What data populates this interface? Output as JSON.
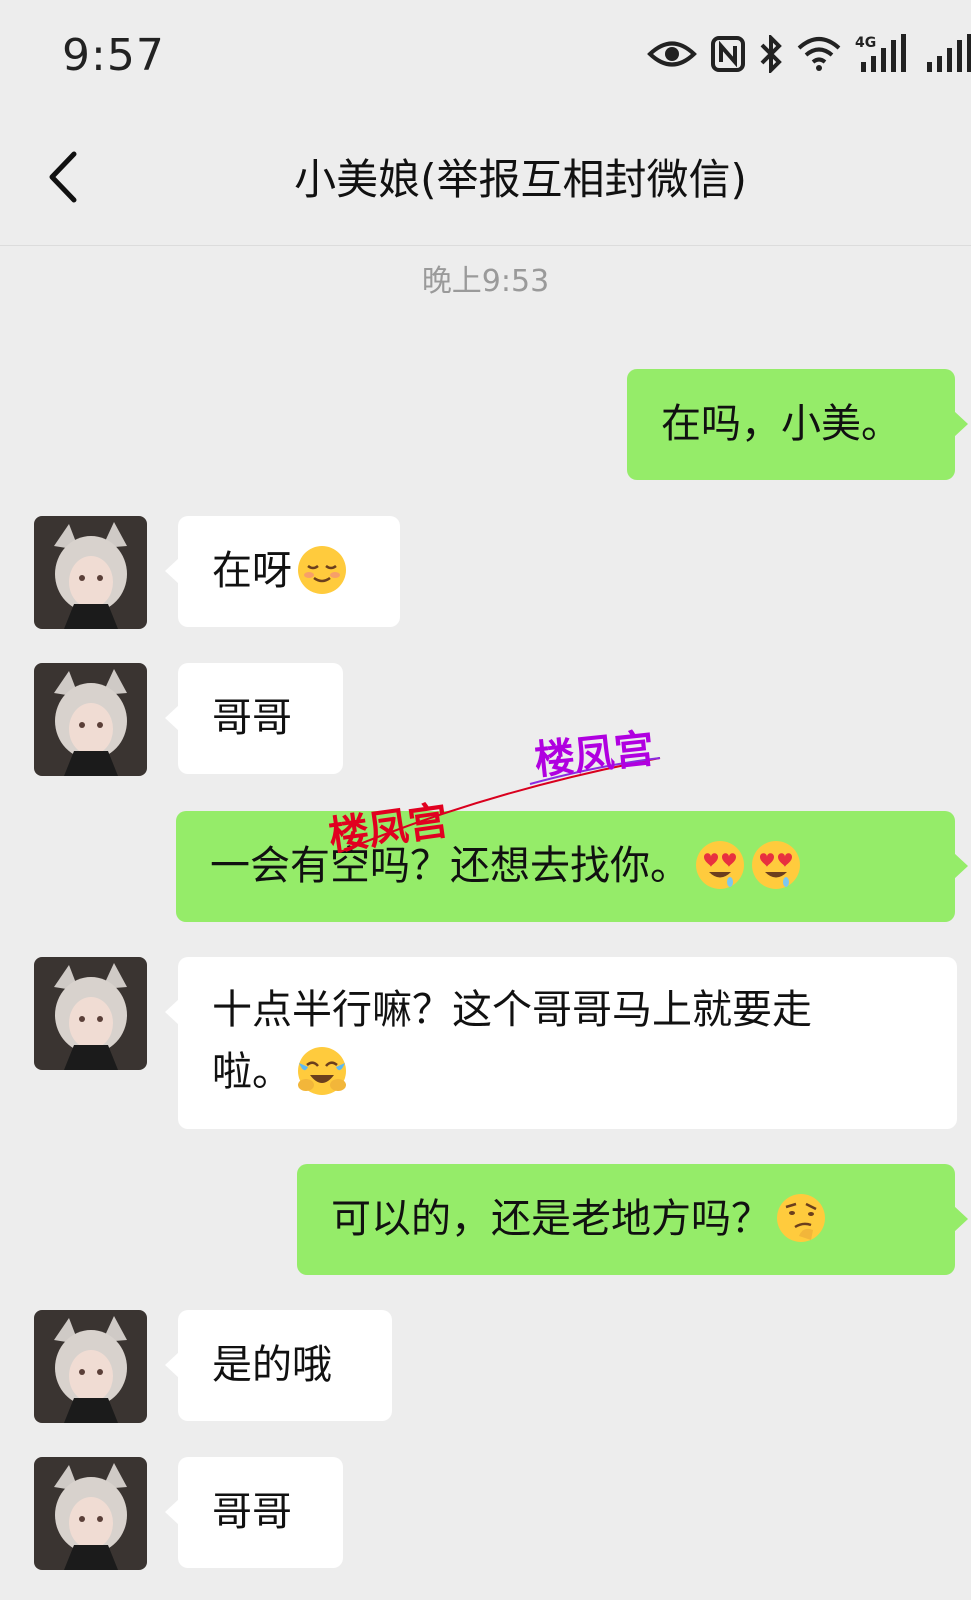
{
  "status_bar": {
    "time": "9:57",
    "icons": [
      "eye-icon",
      "nfc-icon",
      "bluetooth-icon",
      "wifi-icon",
      "4g-signal-icon",
      "signal-icon"
    ],
    "network_label": "4G"
  },
  "header": {
    "title": "小美娘(举报互相封微信)",
    "back_icon": "chevron-left-icon"
  },
  "timestamp": "晚上9:53",
  "messages": [
    {
      "side": "out",
      "text": "在吗，小美。"
    },
    {
      "side": "in",
      "text": "在呀",
      "emoji": "relieved-face-emoji"
    },
    {
      "side": "in",
      "text": "哥哥"
    },
    {
      "side": "out",
      "text": "一会有空吗？还想去找你。",
      "emoji": [
        "heart-eyes-drool-emoji",
        "heart-eyes-drool-emoji"
      ]
    },
    {
      "side": "in",
      "text_line1": "十点半行嘛？这个哥哥马上就要走",
      "text_line2": "啦。",
      "emoji": "crying-laughing-emoji"
    },
    {
      "side": "out",
      "text": "可以的，还是老地方吗？",
      "emoji": "raised-eyebrow-emoji"
    },
    {
      "side": "in",
      "text": "是的哦"
    },
    {
      "side": "in",
      "text": "哥哥"
    }
  ],
  "watermarks": [
    "楼凤宫",
    "楼凤宫"
  ],
  "colors": {
    "background": "#ededed",
    "outgoing_bubble": "#95ec69",
    "incoming_bubble": "#ffffff"
  }
}
